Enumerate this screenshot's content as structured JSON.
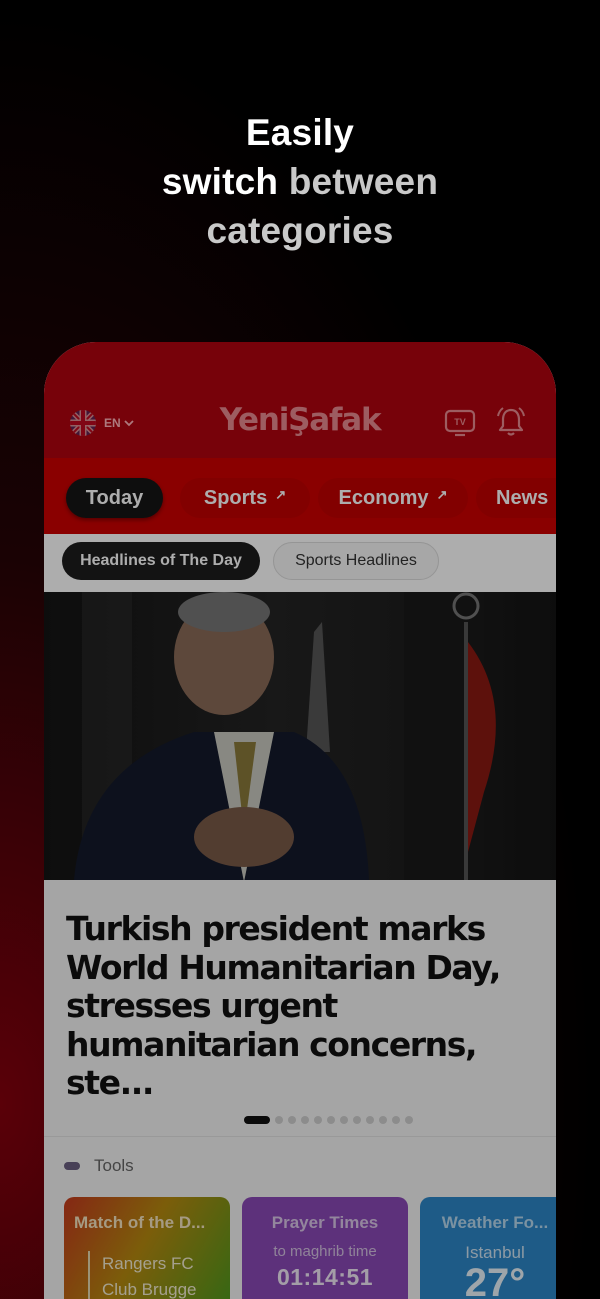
{
  "promo": {
    "line1": "Easily",
    "line2_white": "switch",
    "line2_gray": "between",
    "line3": "categories"
  },
  "header": {
    "language": "EN",
    "logo": "YeniŞafak",
    "tv_label": "TV"
  },
  "categories": [
    {
      "label": "Today",
      "active": true
    },
    {
      "label": "Sports",
      "external": true
    },
    {
      "label": "Economy",
      "external": true
    },
    {
      "label": "News"
    }
  ],
  "subcategories": [
    {
      "label": "Headlines of The Day",
      "active": true
    },
    {
      "label": "Sports Headlines"
    }
  ],
  "featured": {
    "headline": "Turkish president marks World Humanitarian Day, stresses urgent humanitarian concerns, ste...",
    "slide_count": 12,
    "active_slide": 1
  },
  "tools": {
    "label": "Tools",
    "cards": [
      {
        "title": "Match of the D...",
        "team1": "Rangers FC",
        "team2": "Club Brugge"
      },
      {
        "title": "Prayer Times",
        "subtitle": "to maghrib time",
        "countdown": "01:14:51"
      },
      {
        "title": "Weather Fo...",
        "city": "Istanbul",
        "temperature": "27°"
      }
    ]
  },
  "colors": {
    "brand_red": "#cc0000",
    "header_red": "#b00410",
    "match_card": "#b68a10",
    "prayer_card": "#8a49b6",
    "weather_card": "#2d86c7"
  }
}
